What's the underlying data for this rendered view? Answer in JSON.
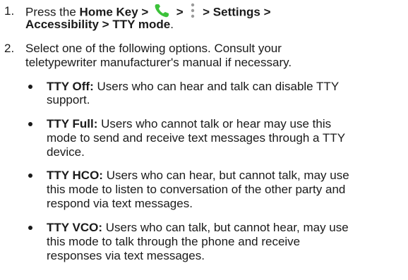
{
  "steps": [
    {
      "number": "1.",
      "line1": {
        "prefix": "Press the ",
        "bold_a": "Home Key > ",
        "bold_b": " > ",
        "bold_c": " > Settings >"
      },
      "line2": "Accessibility > TTY mode",
      "line2_suffix": ".",
      "icons": [
        "phone-icon",
        "more-options-icon"
      ],
      "icon_color": "#3cc23a"
    },
    {
      "number": "2.",
      "lines": [
        "Select one of the following options. Consult your",
        "teletypewriter manufacturer's manual if necessary."
      ]
    }
  ],
  "options": [
    {
      "term": "TTY Off:",
      "lines": [
        " Users who can hear and talk can disable TTY",
        "support."
      ]
    },
    {
      "term": "TTY Full:",
      "lines": [
        " Users who cannot talk or hear may use this",
        "mode to send and receive text messages through a TTY",
        "device."
      ]
    },
    {
      "term": "TTY HCO:",
      "lines": [
        " Users who can hear, but cannot talk, may use",
        "this mode to listen to conversation of the other party and",
        "respond via text messages."
      ]
    },
    {
      "term": "TTY VCO:",
      "lines": [
        " Users who can talk, but cannot hear, may use",
        "this mode to talk through the phone and receive",
        "responses via text messages."
      ]
    }
  ]
}
